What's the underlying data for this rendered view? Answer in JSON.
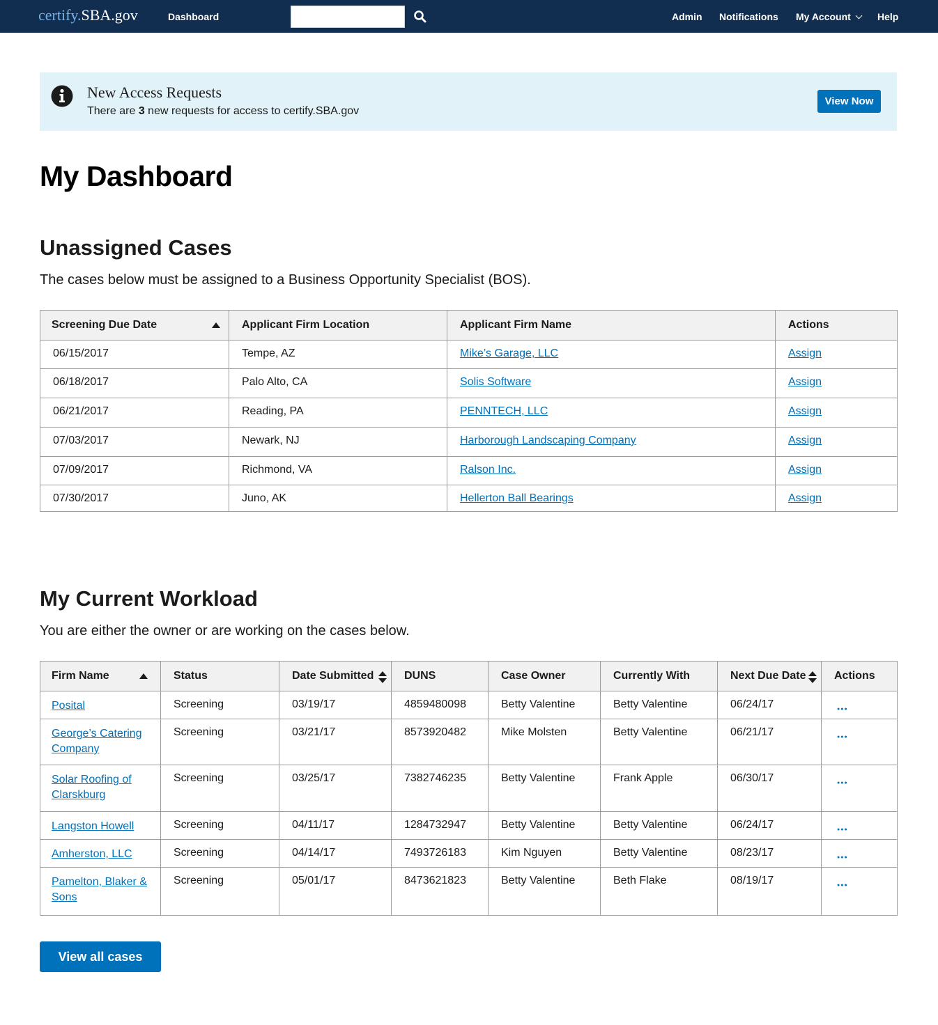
{
  "header": {
    "logo_prefix": "certify.",
    "logo_suffix": "SBA.gov",
    "nav_dashboard": "Dashboard",
    "search_value": "",
    "nav_admin": "Admin",
    "nav_notifications": "Notifications",
    "nav_my_account": "My Account",
    "nav_help": "Help",
    "colors": {
      "bar": "#112e51",
      "accent": "#0071bb",
      "alert_bg": "#e1f2f8"
    }
  },
  "alert": {
    "icon": "info-icon",
    "title": "New Access Requests",
    "text_before": "There are ",
    "count": "3",
    "text_after": " new requests for access to certify.SBA.gov",
    "button": "View Now"
  },
  "page_title": "My Dashboard",
  "unassigned": {
    "title": "Unassigned Cases",
    "description": "The cases below must be assigned to a Business Opportunity Specialist (BOS).",
    "columns": [
      "Screening Due Date",
      "Applicant Firm Location",
      "Applicant Firm Name",
      "Actions"
    ],
    "rows": [
      {
        "due": "06/15/2017",
        "location": "Tempe, AZ",
        "firm": "Mike’s Garage, LLC",
        "action": "Assign"
      },
      {
        "due": "06/18/2017",
        "location": "Palo Alto, CA",
        "firm": "Solis Software",
        "action": "Assign"
      },
      {
        "due": "06/21/2017",
        "location": "Reading, PA",
        "firm": "PENNTECH, LLC",
        "action": "Assign"
      },
      {
        "due": "07/03/2017",
        "location": "Newark, NJ",
        "firm": "Harborough Landscaping Company",
        "action": "Assign"
      },
      {
        "due": "07/09/2017",
        "location": "Richmond, VA",
        "firm": "Ralson Inc.",
        "action": "Assign"
      },
      {
        "due": "07/30/2017",
        "location": "Juno, AK",
        "firm": "Hellerton Ball Bearings",
        "action": "Assign"
      }
    ]
  },
  "workload": {
    "title": "My Current Workload",
    "description": "You are either the owner or are working on the cases below.",
    "columns": [
      "Firm Name",
      "Status",
      "Date Submitted",
      "DUNS",
      "Case Owner",
      "Currently With",
      "Next Due Date",
      "Actions"
    ],
    "rows": [
      {
        "firm": "Posital",
        "status": "Screening",
        "submitted": "03/19/17",
        "duns": "4859480098",
        "owner": "Betty Valentine",
        "with": "Betty Valentine",
        "due": "06/24/17"
      },
      {
        "firm": "George’s Catering Company",
        "status": "Screening",
        "submitted": "03/21/17",
        "duns": "8573920482",
        "owner": "Mike Molsten",
        "with": "Betty Valentine",
        "due": "06/21/17"
      },
      {
        "firm": "Solar Roofing of Clarskburg",
        "status": "Screening",
        "submitted": "03/25/17",
        "duns": "7382746235",
        "owner": "Betty Valentine",
        "with": "Frank Apple",
        "due": "06/30/17"
      },
      {
        "firm": "Langston Howell",
        "status": "Screening",
        "submitted": "04/11/17",
        "duns": "1284732947",
        "owner": "Betty Valentine",
        "with": "Betty Valentine",
        "due": "06/24/17"
      },
      {
        "firm": "Amherston, LLC",
        "status": "Screening",
        "submitted": "04/14/17",
        "duns": "7493726183",
        "owner": "Kim Nguyen",
        "with": "Betty Valentine",
        "due": "08/23/17"
      },
      {
        "firm": "Pamelton, Blaker & Sons",
        "status": "Screening",
        "submitted": "05/01/17",
        "duns": "8473621823",
        "owner": "Betty Valentine",
        "with": "Beth Flake",
        "due": "08/19/17"
      }
    ],
    "actions_icon": "more-dots-icon",
    "view_all": "View all cases"
  }
}
